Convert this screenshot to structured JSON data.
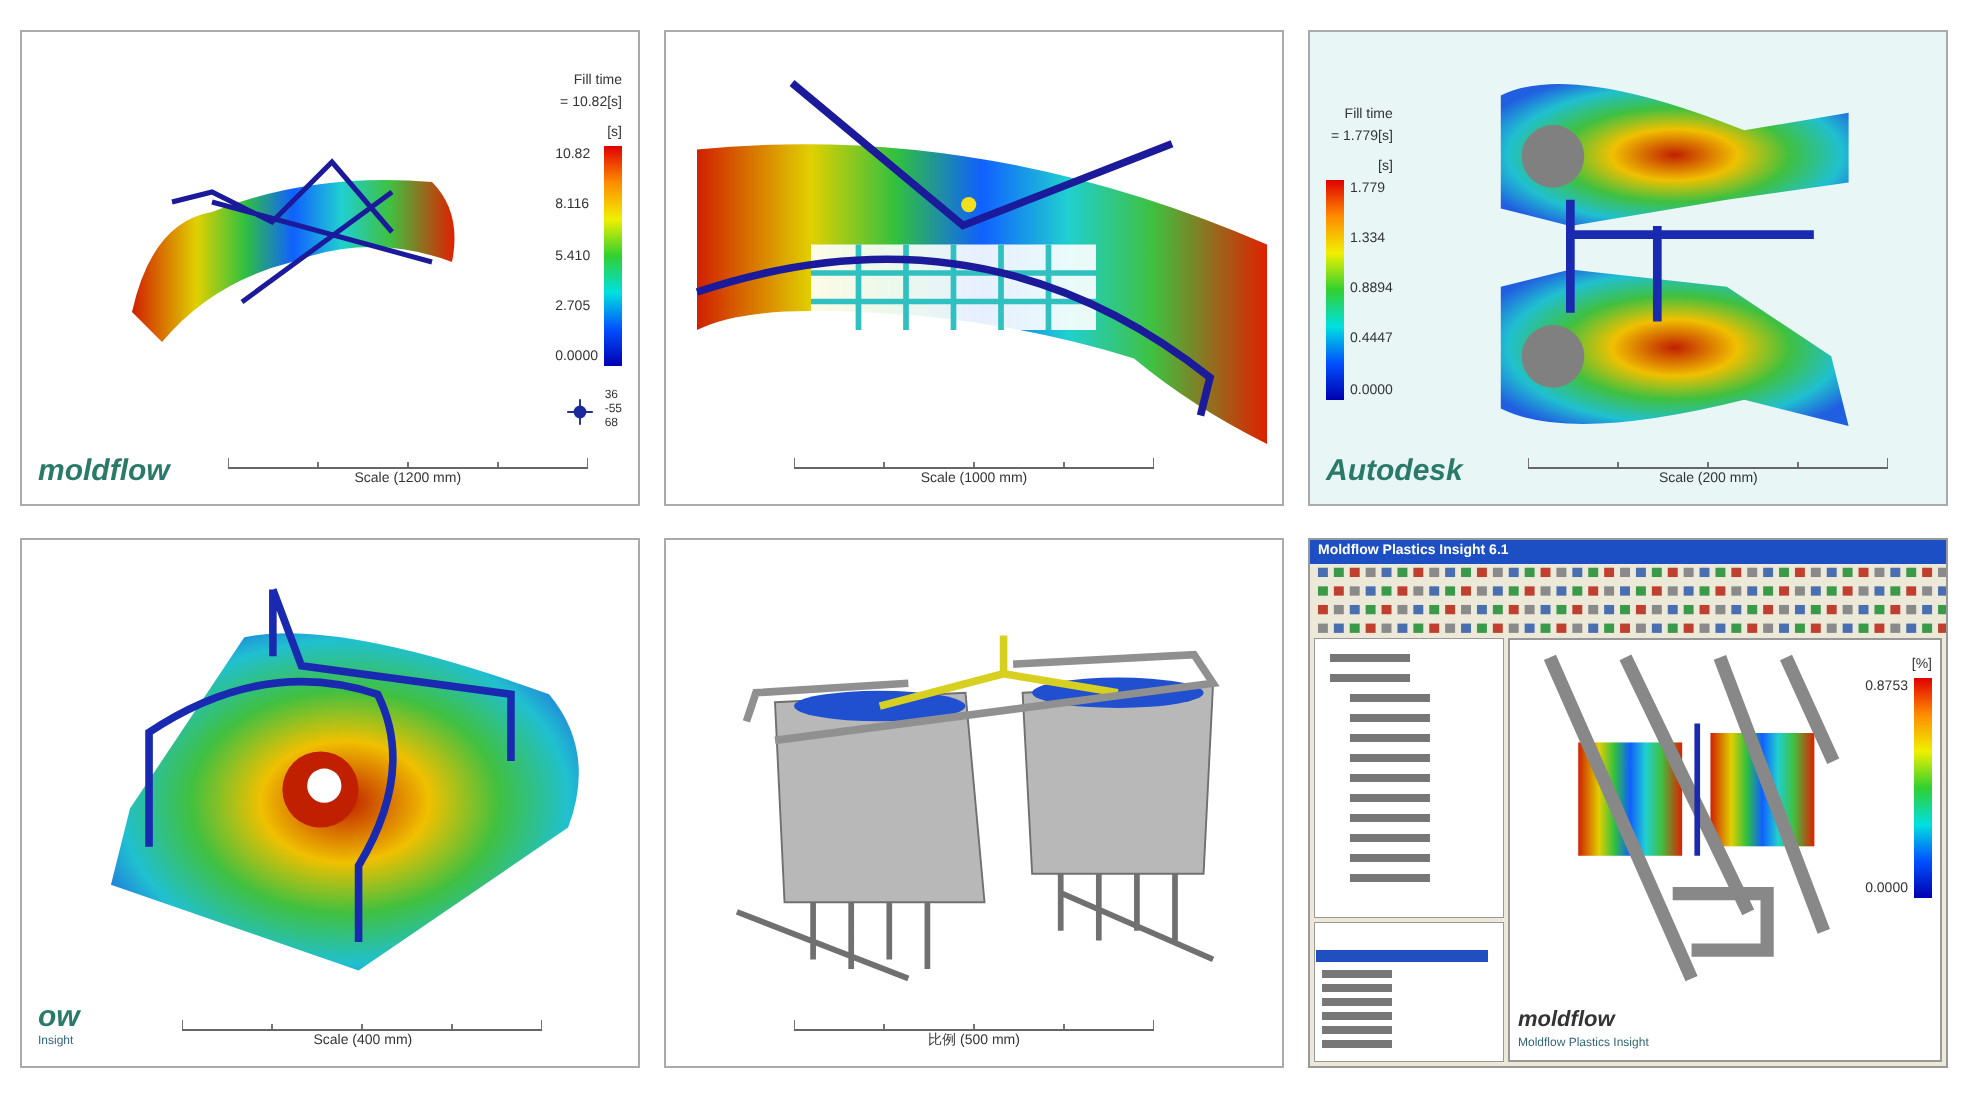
{
  "panels": [
    {
      "kind": "bumper-side",
      "legend": {
        "title": "Fill time",
        "value": "= 10.82[s]",
        "unit": "[s]",
        "ticks": [
          "10.82",
          "8.116",
          "5.410",
          "2.705",
          "0.0000"
        ]
      },
      "orientation": [
        "36",
        "-55",
        "68"
      ],
      "logo": "moldflow",
      "scale": "Scale (1200 mm)"
    },
    {
      "kind": "bumper-front",
      "scale": "Scale (1000 mm)"
    },
    {
      "kind": "manifold",
      "legend": {
        "title": "Fill time",
        "value": "= 1.779[s]",
        "unit": "[s]",
        "ticks": [
          "1.779",
          "1.334",
          "0.8894",
          "0.4447",
          "0.0000"
        ]
      },
      "logo": "Autodesk",
      "scale": "Scale (200 mm)"
    },
    {
      "kind": "plate",
      "logo": "ow",
      "logo_sub": "Insight",
      "scale": "Scale (400 mm)"
    },
    {
      "kind": "baskets",
      "scale": "比例 (500 mm)"
    },
    {
      "kind": "app",
      "window_title": "Moldflow Plastics Insight 6.1",
      "legend": {
        "unit": "[%]",
        "ticks": [
          "0.8753",
          "0.0000"
        ]
      },
      "logo": "moldflow",
      "logo_sub": "Moldflow Plastics Insight"
    }
  ]
}
